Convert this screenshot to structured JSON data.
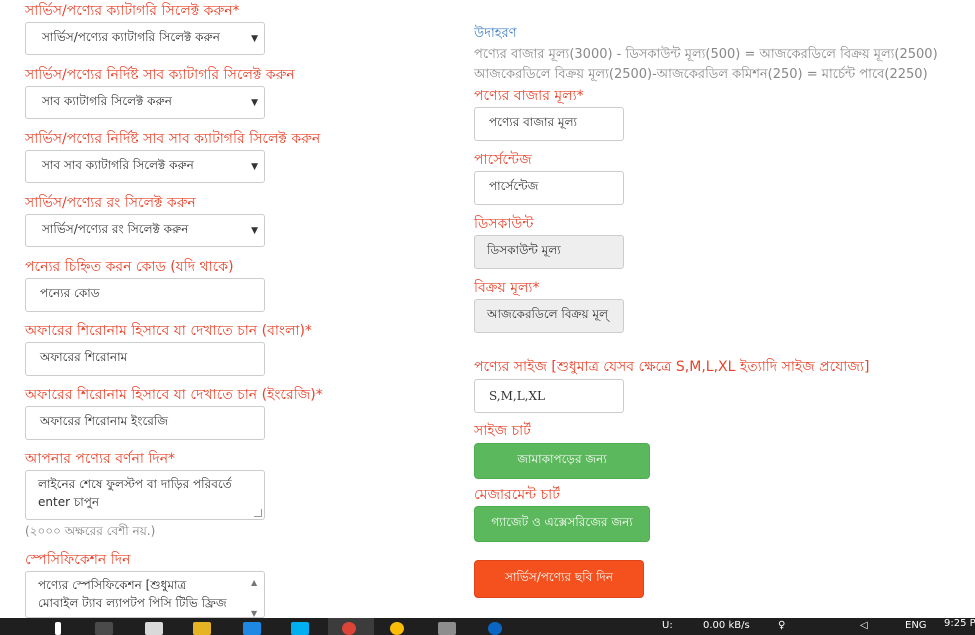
{
  "left": {
    "category": {
      "label": "সার্ভিস/পণ্যের ক্যাটাগরি সিলেক্ট করুন*",
      "selected": "সার্ভিস/পণ্যের ক্যাটাগরি সিলেক্ট করুন"
    },
    "sub_category": {
      "label": "সার্ভিস/পণ্যের নির্দিষ্ট সাব ক্যাটাগরি সিলেক্ট করুন",
      "selected": "সাব ক্যাটাগরি সিলেক্ট করুন"
    },
    "sub_sub_category": {
      "label": "সার্ভিস/পণ্যের নির্দিষ্ট সাব সাব ক্যাটাগরি সিলেক্ট করুন",
      "selected": "সাব সাব ক্যাটাগরি সিলেক্ট করুন"
    },
    "color": {
      "label": "সার্ভিস/পণ্যের রং সিলেক্ট করুন",
      "selected": "সার্ভিস/পণ্যের রং সিলেক্ট করুন"
    },
    "code": {
      "label": "পন্যের চিহ্নিত করন কোড (যদি থাকে)",
      "placeholder": "পন্যের কোড"
    },
    "offer_title_bn": {
      "label": "অফারের শিরোনাম হিসাবে যা দেখাতে চান (বাংলা)*",
      "placeholder": "অফারের শিরোনাম"
    },
    "offer_title_en": {
      "label": "অফারের শিরোনাম হিসাবে যা দেখাতে চান (ইংরেজি)*",
      "placeholder": "অফারের শিরোনাম ইংরেজি"
    },
    "description": {
      "label": "আপনার পণ্যের বর্ণনা দিন*",
      "placeholder_line1": "লাইনের শেষে ফুলস্টপ বা দাড়ির পরিবর্তে",
      "placeholder_line2": "enter চাপুন",
      "hint": "(২০০০ অক্ষরের বেশী নয়.)"
    },
    "specification": {
      "label": "স্পেসিফিকেশন দিন",
      "placeholder_line1": "পণ্যের স্পেসিফিকেশন [শুধুমাত্র",
      "placeholder_line2": "মোবাইল ট্যাব ল্যাপটপ পিসি টিভি ফ্রিজ"
    }
  },
  "right": {
    "example": {
      "heading": "উদাহরণ",
      "line1": "পণ্যের বাজার মূল্য(3000) - ডিসকাউন্ট মূল্য(500) = আজকেরডিলে বিক্রয় মূল্য(2500)",
      "line2": "আজকেরডিলে বিক্রয় মূল্য(2500)-আজকেরডিল কমিশন(250) = মার্চেন্ট পাবে(2250)"
    },
    "market_price": {
      "label": "পণ্যের বাজার মূল্য*",
      "placeholder": "পণ্যের বাজার মূল্য"
    },
    "percentage": {
      "label": "পার্সেন্টেজ",
      "placeholder": "পার্সেন্টেজ"
    },
    "discount": {
      "label": "ডিসকাউন্ট",
      "placeholder": "ডিসকাউন্ট মূল্য"
    },
    "sale_price": {
      "label": "বিক্রয় মূল্য*",
      "placeholder": "আজকেরডিলে বিক্রয় মূল্"
    },
    "size": {
      "label": "পণ্যের সাইজ [শুধুমাত্র যেসব ক্ষেত্রে S,M,L,XL ইত্যাদি সাইজ প্রযোজ্য]",
      "placeholder": "S,M,L,XL"
    },
    "size_chart": {
      "label": "সাইজ চার্ট",
      "button": "জামাকাপড়ের জন্য"
    },
    "measurement_chart": {
      "label": "মেজারমেন্ট চার্ট",
      "button": "গ্যাজেট ও এক্সেসরিজের জন্য"
    },
    "image_button": "সার্ভিস/পণ্যের ছবি দিন"
  },
  "taskbar": {
    "net_label": "U:",
    "net_speed": "0.00 kB/s",
    "lang": "ENG",
    "time": "9:25 P"
  },
  "colors": {
    "label_red": "#e8432b",
    "example_blue": "#3a7bbf",
    "button_green": "#5cb85c",
    "button_orange": "#f4511e"
  }
}
